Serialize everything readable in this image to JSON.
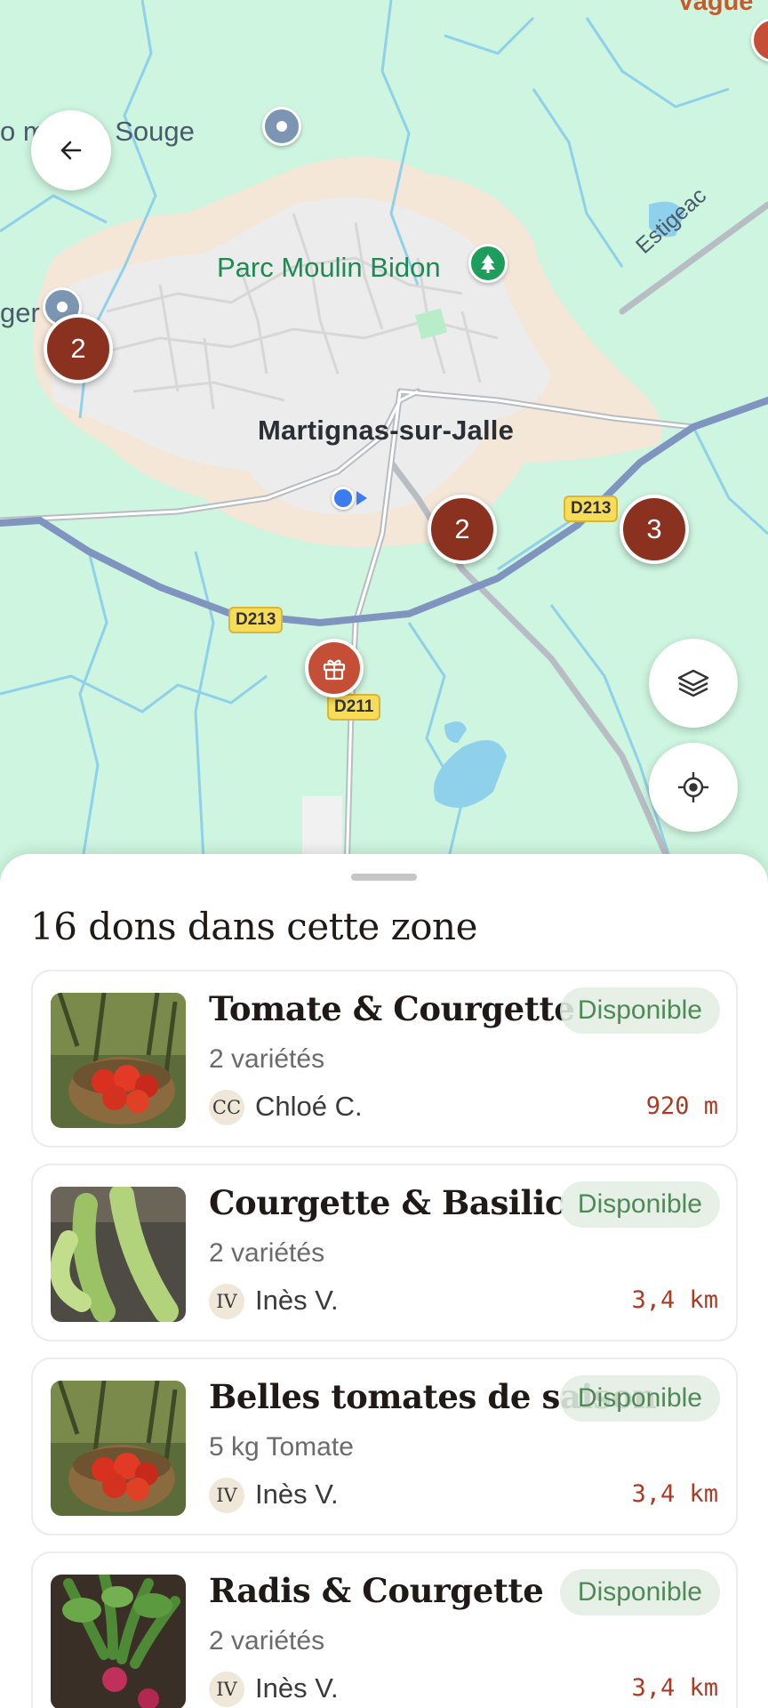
{
  "map": {
    "labels": {
      "souge": "o m  e de Souge",
      "souge_left": "ger",
      "park": "Parc Moulin Bidon",
      "town": "Martignas-sur-Jalle",
      "vague": "Vague",
      "estigeac": "Estigeac"
    },
    "roads": {
      "d213_a": "D213",
      "d213_b": "D213",
      "d211": "D211"
    },
    "clusters": [
      {
        "count": "2"
      },
      {
        "count": "2"
      },
      {
        "count": "3"
      }
    ],
    "icons": {
      "back": "arrow-left-icon",
      "layers": "layers-icon",
      "locate": "my-location-icon",
      "gift": "gift-icon",
      "park": "tree-icon"
    }
  },
  "sheet": {
    "title": "16 dons dans cette zone",
    "items": [
      {
        "title": "Tomate & Courgette",
        "badge": "Disponible",
        "subtitle": "2 variétés",
        "initials": "CC",
        "user": "Chloé C.",
        "distance": "920 m",
        "image": "tomatoes-basket"
      },
      {
        "title": "Courgette & Basilic",
        "badge": "Disponible",
        "subtitle": "2 variétés",
        "initials": "IV",
        "user": "Inès V.",
        "distance": "3,4 km",
        "image": "zucchini"
      },
      {
        "title": "Belles tomates de saison",
        "badge": "Disponible",
        "subtitle": "5 kg Tomate",
        "initials": "IV",
        "user": "Inès V.",
        "distance": "3,4 km",
        "image": "tomatoes-basket"
      },
      {
        "title": "Radis & Courgette",
        "badge": "Disponible",
        "subtitle": "2 variétés",
        "initials": "IV",
        "user": "Inès V.",
        "distance": "3,4 km",
        "image": "radish"
      }
    ]
  },
  "colors": {
    "map_background": "#cdf5df",
    "cluster": "#8a3120",
    "accent_distance": "#a83c26",
    "badge_text": "#4d8a56",
    "park_label": "#1e8a53"
  }
}
